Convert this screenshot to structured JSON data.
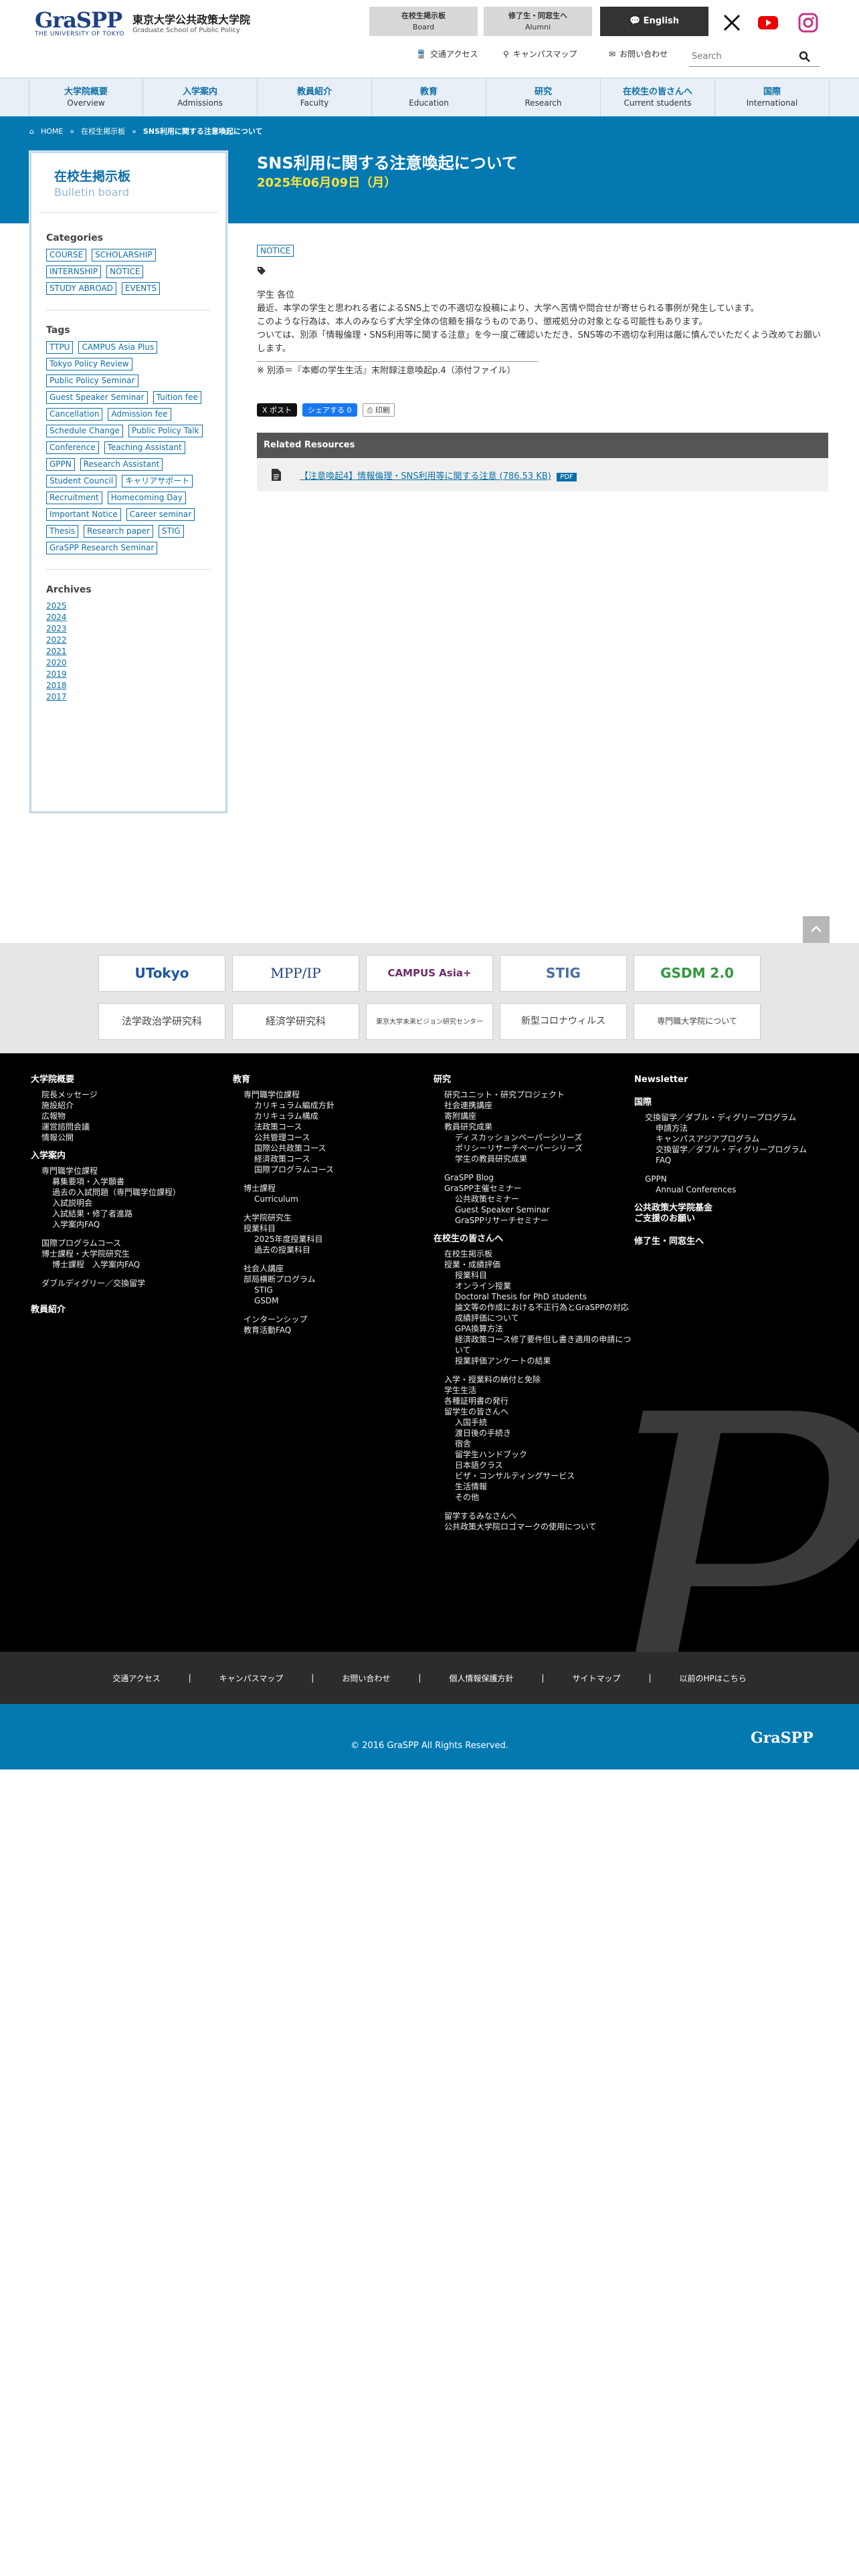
{
  "header": {
    "logo_mark": "GraSPP",
    "logo_sub": "THE UNIVERSITY OF TOKYO",
    "logo_jp": "東京大学公共政策大学院",
    "logo_en": "Graduate School of Public Policy",
    "btn_board_jp": "在校生掲示板",
    "btn_board_en": "Board",
    "btn_alumni_jp": "修了生・同窓生へ",
    "btn_alumni_en": "Alumni",
    "btn_english": "English",
    "access": "交通アクセス",
    "campus_map": "キャンパスマップ",
    "contact": "お問い合わせ",
    "search_placeholder": "Search"
  },
  "nav": [
    {
      "jp": "大学院概要",
      "en": "Overview"
    },
    {
      "jp": "入学案内",
      "en": "Admissions"
    },
    {
      "jp": "教員紹介",
      "en": "Faculty"
    },
    {
      "jp": "教育",
      "en": "Education"
    },
    {
      "jp": "研究",
      "en": "Research"
    },
    {
      "jp": "在校生の皆さんへ",
      "en": "Current students"
    },
    {
      "jp": "国際",
      "en": "International"
    }
  ],
  "breadcrumb": [
    "HOME",
    "在校生掲示板",
    "SNS利用に関する注意喚起について"
  ],
  "page": {
    "title": "SNS利用に関する注意喚起について",
    "date": "2025年06月09日（月）"
  },
  "sidebar": {
    "title_jp": "在校生掲示板",
    "title_en": "Bulletin board",
    "categories_title": "Categories",
    "categories": [
      "COURSE",
      "SCHOLARSHIP",
      "INTERNSHIP",
      "NOTICE",
      "STUDY ABROAD",
      "EVENTS"
    ],
    "tags_title": "Tags",
    "tags": [
      "TTPU",
      "CAMPUS Asia Plus",
      "Tokyo Policy Review",
      "Public Policy Seminar",
      "Guest Speaker Seminar",
      "Tuition fee",
      "Cancellation",
      "Admission fee",
      "Schedule Change",
      "Public Policy Talk",
      "Conference",
      "Teaching Assistant",
      "GPPN",
      "Research Assistant",
      "Student Council",
      "キャリアサポート",
      "Recruitment",
      "Homecoming Day",
      "Important Notice",
      "Career seminar",
      "Thesis",
      "Research paper",
      "STIG",
      "GraSPP Research Seminar"
    ],
    "archives_title": "Archives",
    "archives": [
      "2025",
      "2024",
      "2023",
      "2022",
      "2021",
      "2020",
      "2019",
      "2018",
      "2017"
    ]
  },
  "article": {
    "category": "NOTICE",
    "para1": "学生 各位",
    "para2": "最近、本学の学生と思われる者によるSNS上での不適切な投稿により、大学へ苦情や問合せが寄せられる事例が発生しています。",
    "para3": "このような行為は、本人のみならず大学全体の信頼を損なうものであり、懲戒処分の対象となる可能性もあります。",
    "para4": "ついては、別添「情報倫理・SNS利用等に関する注意」を今一度ご確認いただき、SNS等の不適切な利用は厳に慎んでいただくよう改めてお願いします。",
    "note": "※ 別添＝『本郷の学生生活』末附録注意喚起p.4（添付ファイル）",
    "share_x": "X ポスト",
    "share_fb": "シェアする 0",
    "share_print": "印刷",
    "related_title": "Related Resources",
    "related_link": "【注意喚起4】情報倫理・SNS利用等に関する注意 (786.53 KB)",
    "related_badge": "PDF"
  },
  "banners": [
    {
      "label": "UTokyo"
    },
    {
      "label": "MPP/IP"
    },
    {
      "label": "CAMPUS Asia+"
    },
    {
      "label": "STIG"
    },
    {
      "label": "GSDM 2.0"
    },
    {
      "label": "法学政治学研究科"
    },
    {
      "label": "経済学研究科"
    },
    {
      "label": "東京大学未来ビジョン研究センター"
    },
    {
      "label": "新型コロナウィルス"
    },
    {
      "label": "専門職大学院について"
    }
  ],
  "footer": {
    "col1": {
      "h1": "大学院概要",
      "items1": [
        "院長メッセージ",
        "施設紹介",
        "広報物",
        "運営諮問会議",
        "情報公開"
      ],
      "h2": "入学案内",
      "sub1": "専門職学位課程",
      "items2": [
        "募集要項・入学願書",
        "過去の入試問題（専門職学位課程）",
        "入試説明会",
        "入試結果・修了者進路",
        "入学案内FAQ"
      ],
      "items3": [
        "国際プログラムコース",
        "博士課程・大学院研究生"
      ],
      "items4": [
        "博士課程　入学案内FAQ"
      ],
      "items5": [
        "ダブルディグリー／交換留学"
      ],
      "h3": "教員紹介"
    },
    "col2": {
      "h1": "教育",
      "sub1": "専門職学位課程",
      "items1": [
        "カリキュラム編成方針",
        "カリキュラム構成",
        "法政策コース",
        "公共管理コース",
        "国際公共政策コース",
        "経済政策コース",
        "国際プログラムコース"
      ],
      "sub2": "博士課程",
      "items2": [
        "Curriculum"
      ],
      "sub3": "大学院研究生",
      "sub4": "授業科目",
      "items3": [
        "2025年度授業科目",
        "過去の授業科目"
      ],
      "sub5": "社会人講座",
      "sub6": "部局横断プログラム",
      "items4": [
        "STIG",
        "GSDM"
      ],
      "items5": [
        "インターンシップ",
        "教育活動FAQ"
      ]
    },
    "col3": {
      "h1": "研究",
      "items1": [
        "研究ユニット・研究プロジェクト",
        "社会連携講座",
        "寄附講座",
        "教員研究成果"
      ],
      "items2": [
        "ディスカッションペーパーシリーズ",
        "ポリシーリサーチペーパーシリーズ",
        "学生の教員研究成果"
      ],
      "items3": [
        "GraSPP Blog",
        "GraSPP主催セミナー"
      ],
      "items4": [
        "公共政策セミナー",
        "Guest Speaker Seminar",
        "GraSPPリサーチセミナー"
      ],
      "h2": "在校生の皆さんへ",
      "items5": [
        "在校生掲示板",
        "授業・成績評価"
      ],
      "items6": [
        "授業科目",
        "オンライン授業",
        "Doctoral Thesis for PhD students",
        "論文等の作成における不正行為とGraSPPの対応",
        "成績評価について",
        "GPA換算方法",
        "経済政策コース修了要件但し書き適用の申請について",
        "授業評価アンケートの結果"
      ],
      "items7": [
        "入学・授業料の納付と免除",
        "学生生活",
        "各種証明書の発行",
        "留学生の皆さんへ"
      ],
      "items8": [
        "入国手続",
        "渡日後の手続き",
        "宿舎",
        "留学生ハンドブック",
        "日本語クラス",
        "ビザ・コンサルティングサービス",
        "生活情報",
        "その他"
      ],
      "items9": [
        "留学するみなさんへ",
        "公共政策大学院ロゴマークの使用について"
      ]
    },
    "col4": {
      "h1": "Newsletter",
      "h2": "国際",
      "items1": [
        "交換留学／ダブル・ディグリープログラム"
      ],
      "items2": [
        "申請方法",
        "キャンパスアジアプログラム",
        "交換留学／ダブル・ディグリープログラム",
        "FAQ"
      ],
      "items3": [
        "GPPN"
      ],
      "items4": [
        "Annual Conferences"
      ],
      "h3": "公共政策大学院基金",
      "h3b": "ご支援のお願い",
      "h4": "修了生・同窓生へ"
    }
  },
  "footer_bar": [
    "交通アクセス",
    "キャンパスマップ",
    "お問い合わせ",
    "個人情報保護方針",
    "サイトマップ",
    "以前のHPはこちら"
  ],
  "copyright": "© 2016 GraSPP All Rights Reserved.",
  "footer_logo": "GraSPP",
  "colors": {
    "primary": "#0479b1",
    "link": "#0d6fa6",
    "date": "#ffe23b"
  }
}
